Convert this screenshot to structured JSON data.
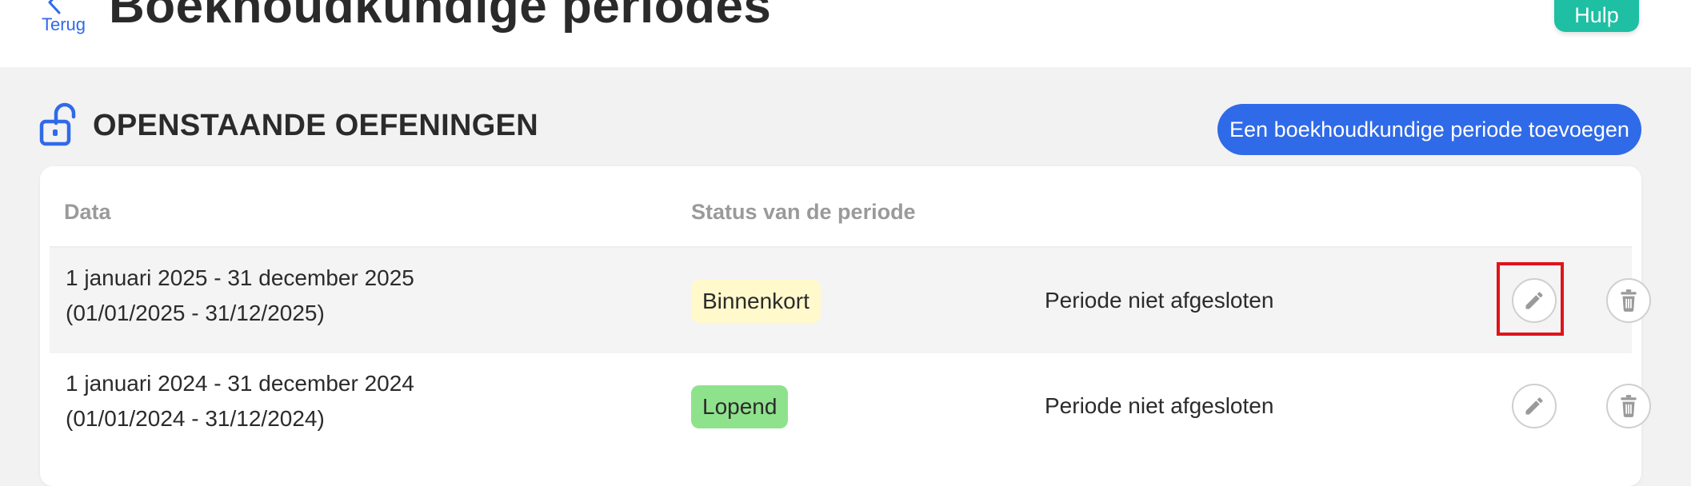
{
  "header": {
    "back_label": "Terug",
    "title": "Boekhoudkundige periodes",
    "help_label": "Hulp"
  },
  "section": {
    "title": "OPENSTAANDE OEFENINGEN",
    "add_button_label": "Een boekhoudkundige periode toevoegen"
  },
  "table": {
    "columns": [
      "Data",
      "Status van de periode"
    ],
    "rows": [
      {
        "date_long": "1 januari 2025 - 31 december 2025",
        "date_short": "(01/01/2025 - 31/12/2025)",
        "status": "Binnenkort",
        "closure": "Periode niet afgesloten"
      },
      {
        "date_long": "1 januari 2024 - 31 december 2024",
        "date_short": "(01/01/2024 - 31/12/2024)",
        "status": "Lopend",
        "closure": "Periode niet afgesloten"
      }
    ]
  },
  "colors": {
    "accent_blue": "#2f6ae8",
    "help_teal": "#1fbfa3",
    "badge_soon": "#fff9cc",
    "badge_running": "#8fe28c",
    "highlight_red": "#e0141b"
  },
  "icons": {
    "back": "chevron-left-icon",
    "section": "unlock-icon",
    "edit": "pencil-icon",
    "delete": "trash-icon"
  }
}
